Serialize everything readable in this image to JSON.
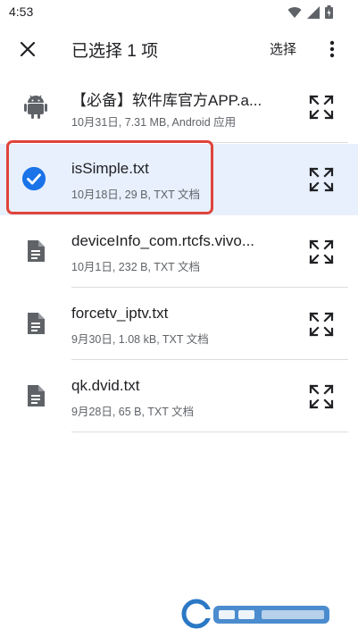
{
  "status_bar": {
    "time": "4:53"
  },
  "app_bar": {
    "title": "已选择 1 项",
    "select_label": "选择"
  },
  "files": [
    {
      "name": "【必备】软件库官方APP.a...",
      "meta": "10月31日, 7.31 MB, Android 应用",
      "icon": "android-icon",
      "selected": false
    },
    {
      "name": "isSimple.txt",
      "meta": "10月18日, 29 B, TXT 文档",
      "icon": "check-icon",
      "selected": true
    },
    {
      "name": "deviceInfo_com.rtcfs.vivo...",
      "meta": "10月1日, 232 B, TXT 文档",
      "icon": "document-icon",
      "selected": false
    },
    {
      "name": "forcetv_iptv.txt",
      "meta": "9月30日, 1.08 kB, TXT 文档",
      "icon": "document-icon",
      "selected": false
    },
    {
      "name": "qk.dvid.txt",
      "meta": "9月28日, 65 B, TXT 文档",
      "icon": "document-icon",
      "selected": false
    }
  ],
  "colors": {
    "accent": "#1a73e8",
    "selected_bg": "#e8f0fe",
    "highlight": "#e0433a"
  }
}
